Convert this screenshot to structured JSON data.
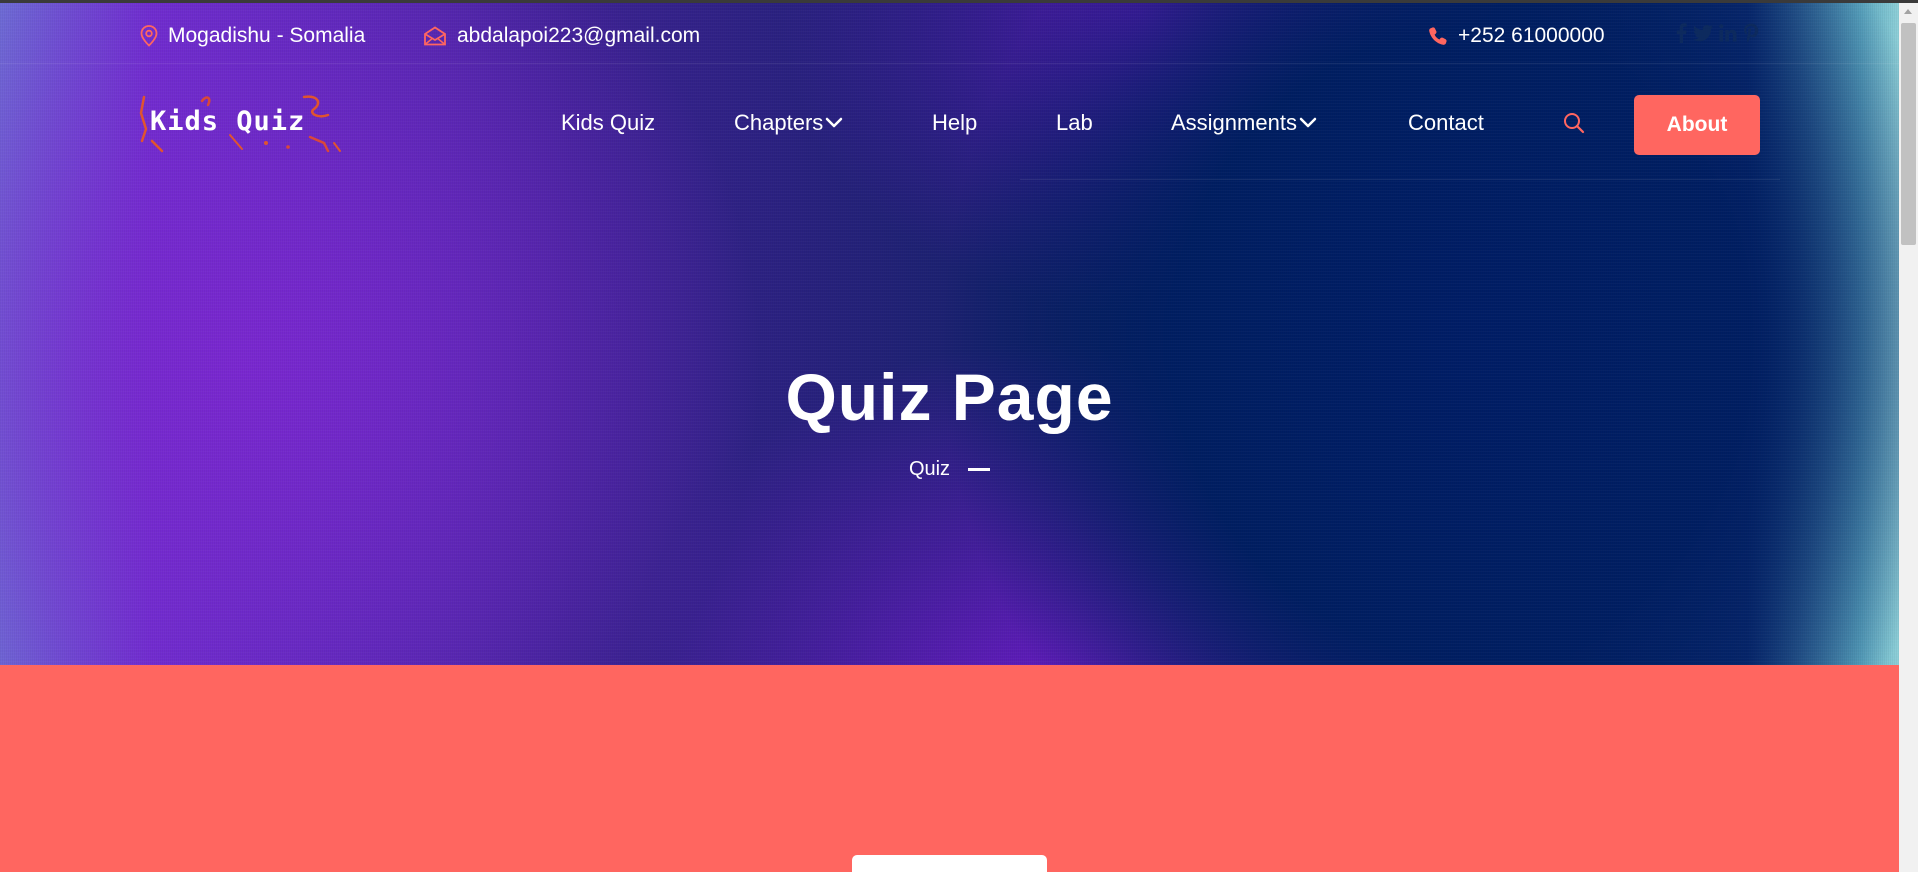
{
  "topbar": {
    "location": "Mogadishu - Somalia",
    "email": "abdalapoi223@gmail.com",
    "phone": "+252 61000000",
    "social_icons": [
      "facebook-icon",
      "twitter-icon",
      "linkedin-icon",
      "pinterest-icon"
    ]
  },
  "logo": {
    "text": "Kids Quiz"
  },
  "nav": {
    "items": [
      {
        "label": "Kids Quiz"
      },
      {
        "label": "Chapters"
      },
      {
        "label": "Help"
      },
      {
        "label": "Lab"
      },
      {
        "label": "Assignments"
      },
      {
        "label": "Contact"
      }
    ],
    "button": "About"
  },
  "hero": {
    "title": "Quiz Page",
    "breadcrumb": "Quiz"
  },
  "colors": {
    "accent": "#ff6660",
    "hero_dark": "#001e62",
    "hero_purple": "#7a28d0",
    "text": "#ffffff"
  }
}
